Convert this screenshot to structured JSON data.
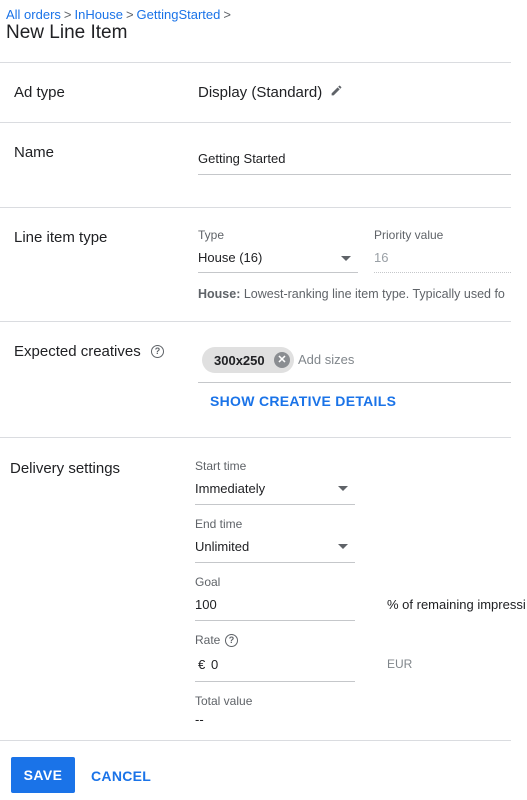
{
  "breadcrumb": {
    "items": [
      "All orders",
      "InHouse",
      "GettingStarted"
    ],
    "separator": ">"
  },
  "page": {
    "title": "New Line Item"
  },
  "ad_type": {
    "label": "Ad type",
    "value": "Display (Standard)",
    "edit_icon": "pencil-icon"
  },
  "name": {
    "label": "Name",
    "value": "Getting Started"
  },
  "line_item_type": {
    "label": "Line item type",
    "type_label": "Type",
    "type_value": "House (16)",
    "priority_label": "Priority value",
    "priority_value": "16",
    "description_bold": "House:",
    "description": "Lowest-ranking line item type. Typically used fo"
  },
  "expected_creatives": {
    "label": "Expected creatives",
    "help_icon": "?",
    "chip": "300x250",
    "chip_remove": "✕",
    "add_sizes_placeholder": "Add sizes",
    "show_details": "SHOW CREATIVE DETAILS"
  },
  "delivery": {
    "label": "Delivery settings",
    "start_label": "Start time",
    "start_value": "Immediately",
    "end_label": "End time",
    "end_value": "Unlimited",
    "goal_label": "Goal",
    "goal_value": "100",
    "goal_suffix": "% of remaining impressi",
    "rate_label": "Rate",
    "rate_help_icon": "?",
    "rate_currency_symbol": "€",
    "rate_value": "0",
    "rate_currency": "EUR",
    "total_label": "Total value",
    "total_value": "--"
  },
  "actions": {
    "save": "SAVE",
    "cancel": "CANCEL"
  },
  "colors": {
    "accent": "#1a73e8",
    "divider": "#dadce0",
    "chip": "#e0e0e0"
  }
}
